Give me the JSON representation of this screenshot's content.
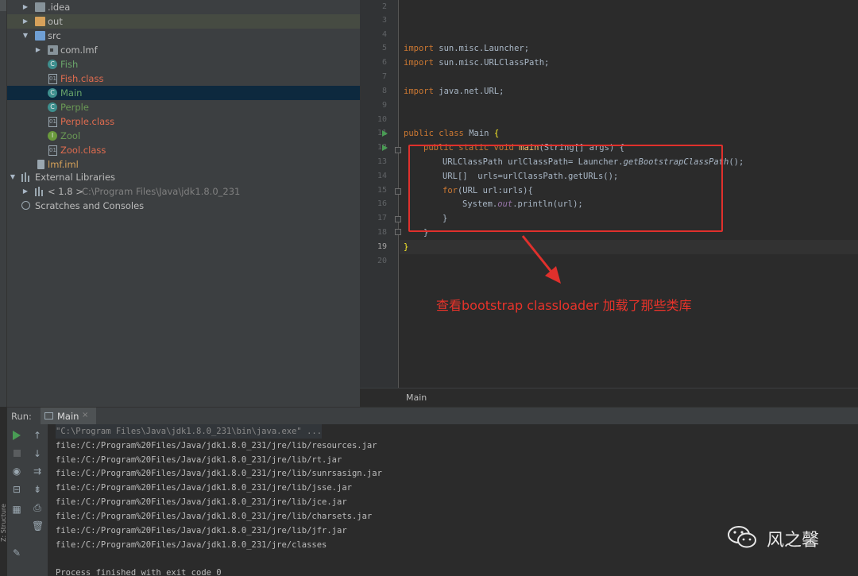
{
  "project_tree": {
    "items": [
      {
        "label": ".idea"
      },
      {
        "label": "out"
      },
      {
        "label": "src"
      },
      {
        "label": "com.lmf"
      },
      {
        "label": "Fish"
      },
      {
        "label": "Fish.class"
      },
      {
        "label": "Main"
      },
      {
        "label": "Perple"
      },
      {
        "label": "Perple.class"
      },
      {
        "label": "Zool"
      },
      {
        "label": "Zool.class"
      },
      {
        "label": "lmf.iml"
      },
      {
        "label": "External Libraries"
      },
      {
        "label": "< 1.8 >",
        "extra": "C:\\Program Files\\Java\\jdk1.8.0_231"
      },
      {
        "label": "Scratches and Consoles"
      }
    ]
  },
  "editor": {
    "line_numbers": [
      "2",
      "3",
      "4",
      "5",
      "6",
      "7",
      "8",
      "9",
      "10",
      "11",
      "12",
      "13",
      "14",
      "15",
      "16",
      "17",
      "18",
      "19",
      "20"
    ],
    "code": {
      "l5": {
        "kw": "import",
        "rest": " sun.misc.Launcher;"
      },
      "l6": {
        "kw": "import",
        "rest": " sun.misc.URLClassPath;"
      },
      "l8": {
        "kw": "import",
        "rest": " java.net.URL;"
      },
      "l11": {
        "kw1": "public",
        "kw2": "class",
        "name": " Main ",
        "brace": "{"
      },
      "l12": {
        "kw1": "public",
        "kw2": "static",
        "kw3": "void",
        "fn": "main",
        "rest": "(String[] args) {"
      },
      "l13": {
        "pre": "URLClassPath urlClassPath= Launcher.",
        "it": "getBootstrapClassPath",
        "post": "();"
      },
      "l14": {
        "text": "URL[]  urls=urlClassPath.getURLs();"
      },
      "l15": {
        "kw": "for",
        "rest": "(URL url:urls){"
      },
      "l16": {
        "pre": "System.",
        "st": "out",
        "post": ".println(url);"
      },
      "l17": {
        "text": "}"
      },
      "l18": {
        "text": "}"
      },
      "l19": {
        "text": "}"
      }
    },
    "breadcrumb": "Main"
  },
  "annotation": {
    "text": "查看bootstrap classloader 加载了那些类库",
    "color": "#e8332a"
  },
  "run_panel": {
    "label": "Run:",
    "tab": "Main",
    "lines": [
      "\"C:\\Program Files\\Java\\jdk1.8.0_231\\bin\\java.exe\" ...",
      "file:/C:/Program%20Files/Java/jdk1.8.0_231/jre/lib/resources.jar",
      "file:/C:/Program%20Files/Java/jdk1.8.0_231/jre/lib/rt.jar",
      "file:/C:/Program%20Files/Java/jdk1.8.0_231/jre/lib/sunrsasign.jar",
      "file:/C:/Program%20Files/Java/jdk1.8.0_231/jre/lib/jsse.jar",
      "file:/C:/Program%20Files/Java/jdk1.8.0_231/jre/lib/jce.jar",
      "file:/C:/Program%20Files/Java/jdk1.8.0_231/jre/lib/charsets.jar",
      "file:/C:/Program%20Files/Java/jdk1.8.0_231/jre/lib/jfr.jar",
      "file:/C:/Program%20Files/Java/jdk1.8.0_231/jre/classes",
      "",
      "Process finished with exit code 0"
    ]
  },
  "side_tabs": {
    "structure": "Z: Structure"
  },
  "watermark": {
    "text": "风之馨"
  },
  "colors": {
    "accent_red": "#e0302c",
    "run_green": "#499c54",
    "keyword": "#cc7832"
  }
}
